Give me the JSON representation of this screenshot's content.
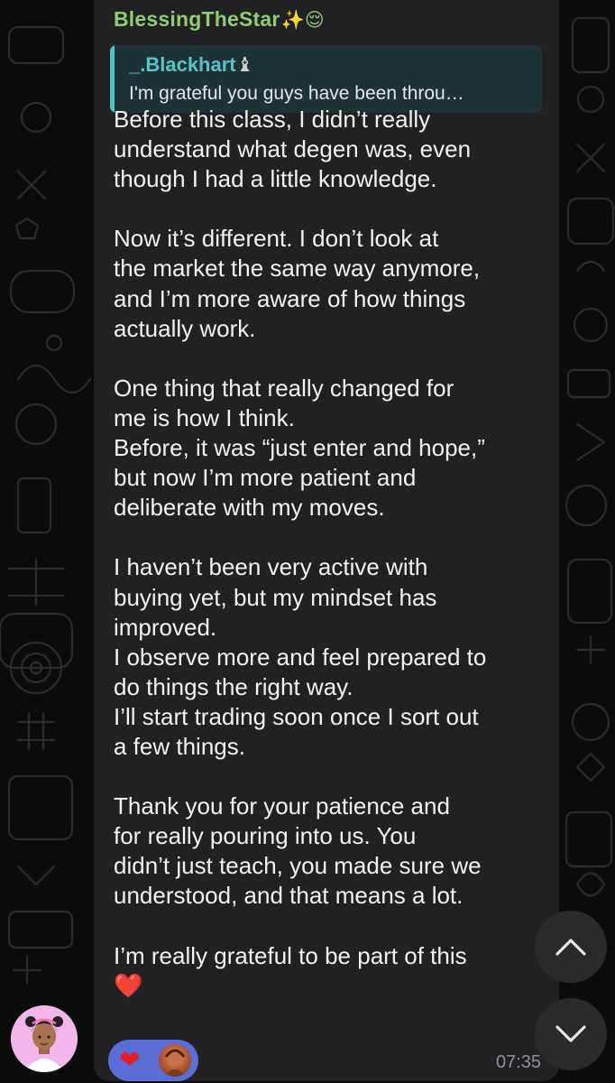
{
  "colors": {
    "background": "#0c0c0d",
    "bubble": "#212123",
    "sender_name": "#8fcc73",
    "reply_accent": "#4ec4c9",
    "reaction_pill": "#5b6ed8",
    "heart": "#e3202d"
  },
  "message": {
    "sender": "BlessingTheStar",
    "sender_emoji": "✨😌",
    "reply": {
      "name": "_.Blackhart",
      "name_emoji": "♝",
      "text": "I'm grateful you guys have been throu…"
    },
    "paragraphs": [
      "Before this class, I didn’t really\nunderstand what degen was, even\nthough I had a little knowledge.",
      "Now it’s different. I don’t look at\nthe market the same way anymore,\nand I’m more aware of how things\nactually work.",
      "One thing that really changed for\nme is how I think.\nBefore, it was “just enter and hope,”\nbut now I’m more patient and\ndeliberate with my moves.",
      "I haven’t been very active with\nbuying yet, but my mindset has\nimproved.\nI observe more and feel prepared to\ndo things the right way.\nI’ll start trading soon once I sort out\na few things.",
      "Thank you for your patience and\nfor really pouring into us. You\ndidn’t just teach, you made sure we\nunderstood, and that means a lot.",
      "I’m really grateful to be part of this"
    ],
    "closing_emoji": "❤️",
    "reaction_emoji": "❤",
    "time": "07:35"
  },
  "icons": {
    "scroll_up": "chevron-up-icon",
    "scroll_down": "chevron-down-icon",
    "avatar": "user-avatar"
  }
}
